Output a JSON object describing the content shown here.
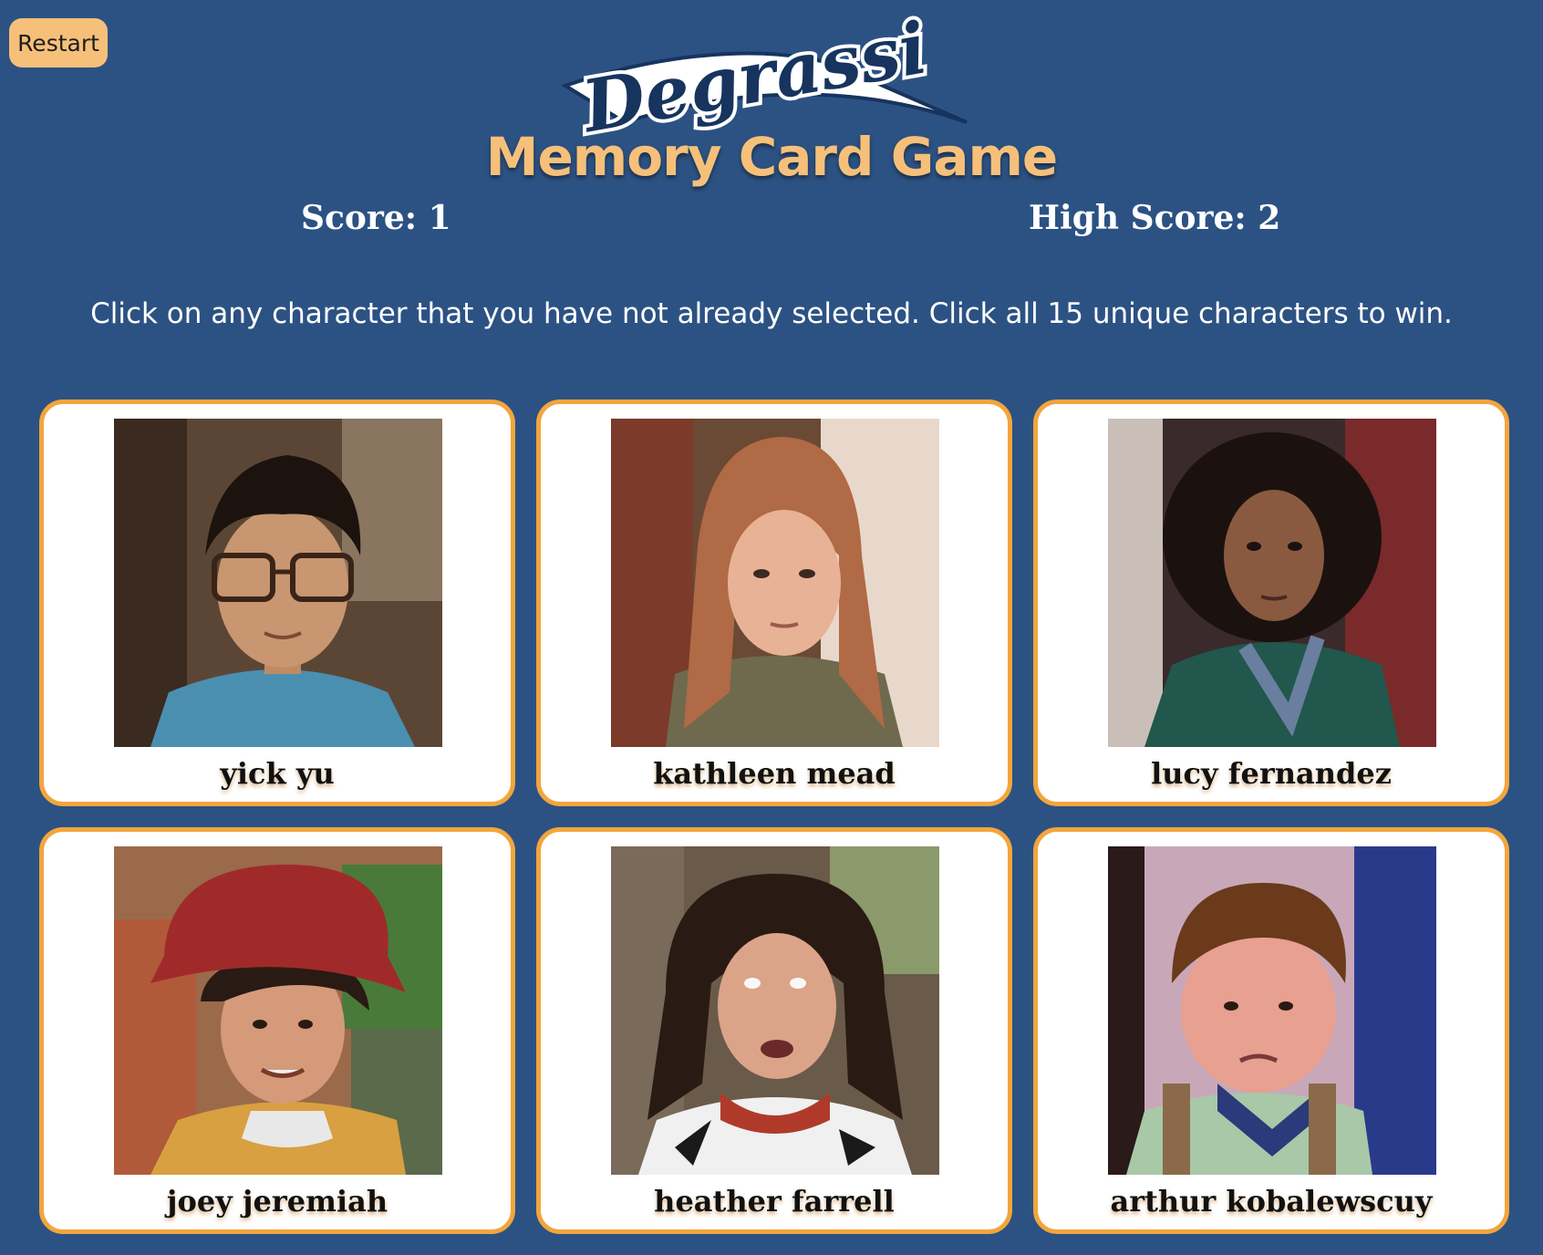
{
  "restart": {
    "label": "Restart"
  },
  "header": {
    "logo_text": "Degrassi",
    "title": "Memory Card Game"
  },
  "scoreboard": {
    "score": "Score: 1",
    "high_score": "High Score: 2",
    "score_value": 1,
    "high_score_value": 2
  },
  "instructions": "Click on any character that you have not already selected. Click all 15 unique characters to win.",
  "cards": [
    {
      "name": "yick yu"
    },
    {
      "name": "kathleen mead"
    },
    {
      "name": "lucy fernandez"
    },
    {
      "name": "joey jeremiah"
    },
    {
      "name": "heather farrell"
    },
    {
      "name": "arthur kobalewscuy"
    }
  ],
  "colors": {
    "background": "#2c5283",
    "accent": "#f6c07a",
    "card_border": "#f3a53c",
    "card_background": "#ffffff"
  }
}
